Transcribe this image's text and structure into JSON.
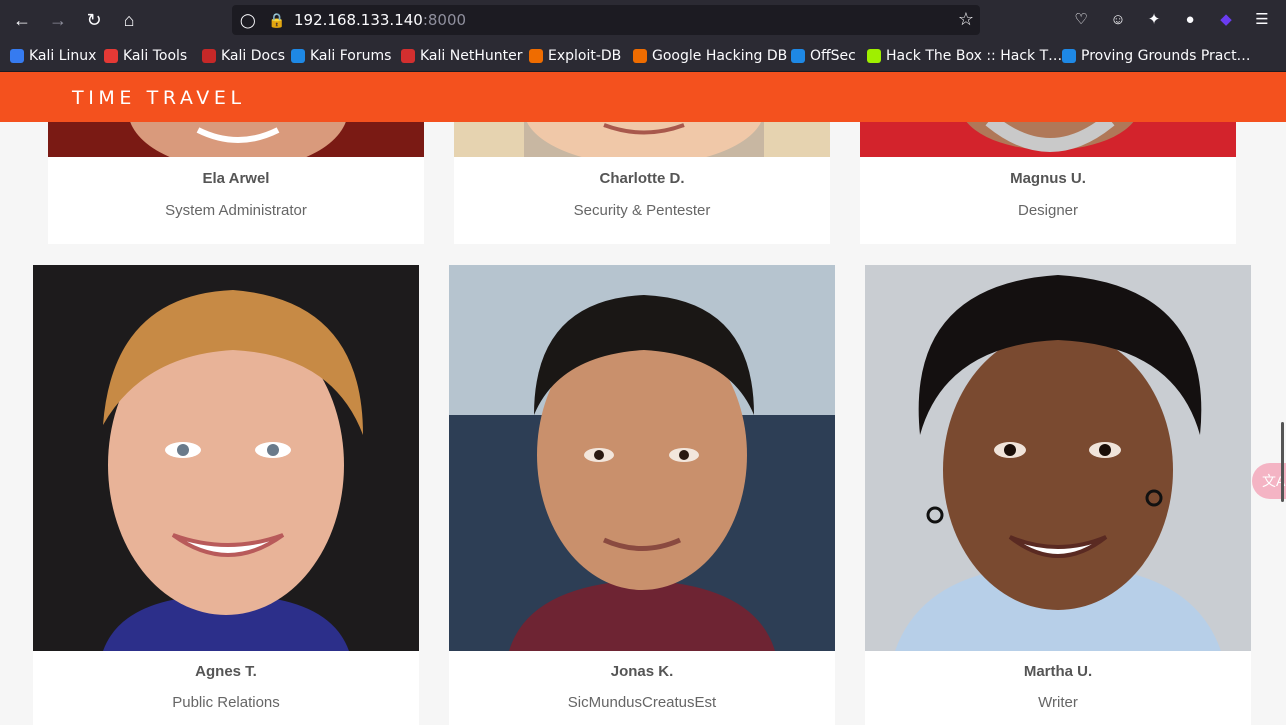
{
  "browser": {
    "url_host": "192.168.133.140",
    "url_port": ":8000"
  },
  "bookmarks": [
    {
      "label": "Kali Linux",
      "color": "#367bf0"
    },
    {
      "label": "Kali Tools",
      "color": "#e53935"
    },
    {
      "label": "Kali Docs",
      "color": "#c62828"
    },
    {
      "label": "Kali Forums",
      "color": "#1e88e5"
    },
    {
      "label": "Kali NetHunter",
      "color": "#d32f2f"
    },
    {
      "label": "Exploit-DB",
      "color": "#ef6c00"
    },
    {
      "label": "Google Hacking DB",
      "color": "#ef6c00"
    },
    {
      "label": "OffSec",
      "color": "#1e88e5"
    },
    {
      "label": "Hack The Box :: Hack T…",
      "color": "#9fef00"
    },
    {
      "label": "Proving Grounds Pract…",
      "color": "#1e88e5"
    }
  ],
  "site": {
    "brand": "TIME TRAVEL",
    "accent": "#f4511e"
  },
  "team": [
    {
      "name": "Ela Arwel",
      "role": "System Administrator"
    },
    {
      "name": "Charlotte D.",
      "role": "Security & Pentester"
    },
    {
      "name": "Magnus U.",
      "role": "Designer"
    },
    {
      "name": "Agnes T.",
      "role": "Public Relations"
    },
    {
      "name": "Jonas K.",
      "role": "SicMundusCreatusEst"
    },
    {
      "name": "Martha U.",
      "role": "Writer"
    }
  ],
  "translate_widget": "文A"
}
